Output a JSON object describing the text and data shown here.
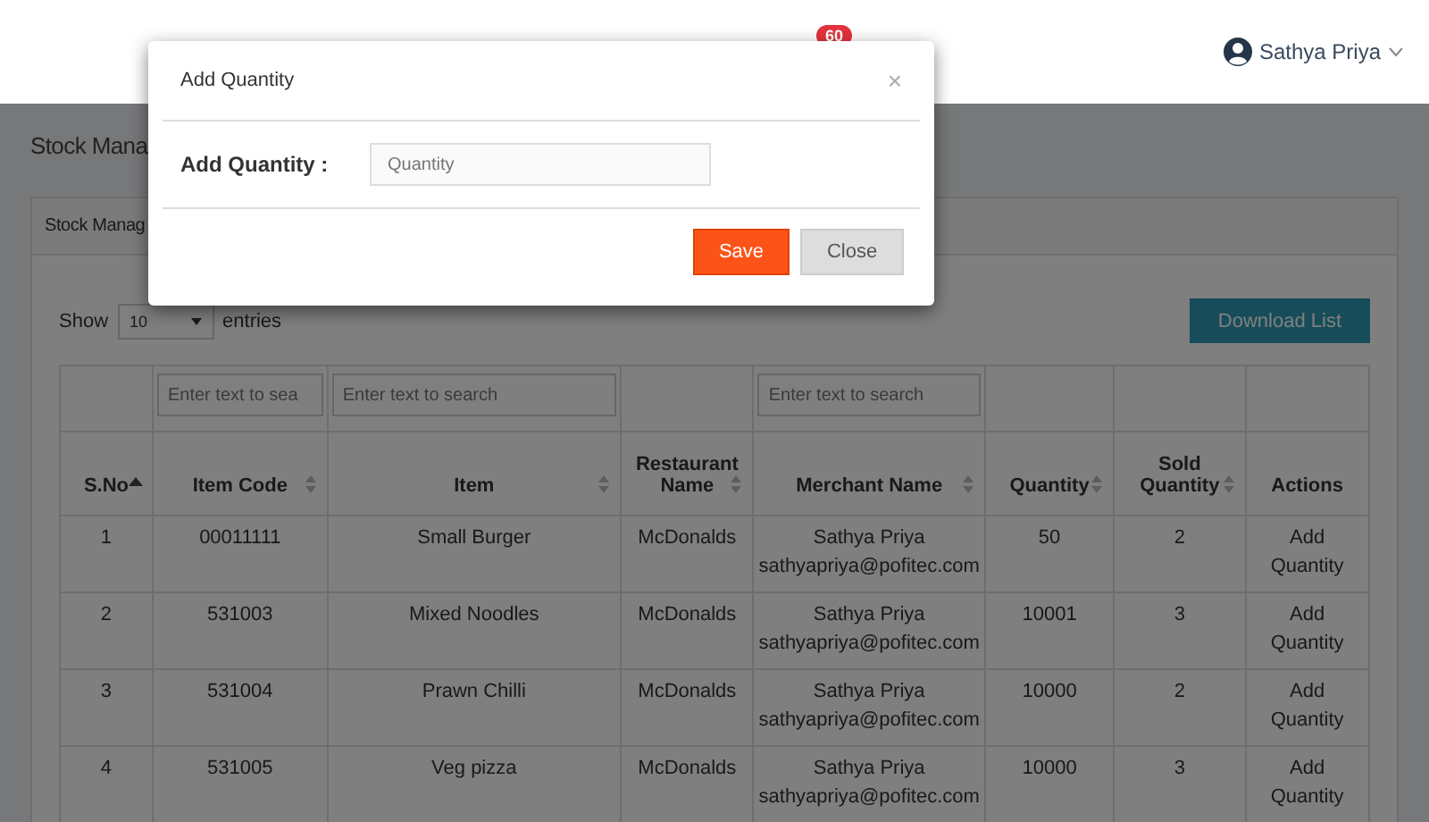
{
  "header": {
    "notification_badge": "60",
    "user_name": "Sathya Priya"
  },
  "page_title": "Stock Mana",
  "card_title": "Stock Manag",
  "length_control": {
    "label_before": "Show",
    "value": "10",
    "label_after": "entries"
  },
  "download_button": "Download List",
  "table": {
    "filters": [
      {
        "kind": "none"
      },
      {
        "kind": "input",
        "placeholder": "Enter text to sea"
      },
      {
        "kind": "input",
        "placeholder": "Enter text to search"
      },
      {
        "kind": "none"
      },
      {
        "kind": "input",
        "placeholder": "Enter text to search"
      },
      {
        "kind": "none"
      },
      {
        "kind": "none"
      },
      {
        "kind": "none"
      }
    ],
    "columns": [
      {
        "label": "S.No",
        "sorted": true
      },
      {
        "label": "Item Code",
        "sorted": false
      },
      {
        "label": "Item",
        "sorted": false
      },
      {
        "label": "Restaurant Name",
        "sorted": false
      },
      {
        "label": "Merchant Name",
        "sorted": false
      },
      {
        "label": "Quantity",
        "sorted": false
      },
      {
        "label": "Sold Quantity",
        "sorted": false
      },
      {
        "label": "Actions"
      }
    ],
    "rows": [
      {
        "sno": "1",
        "item_code": "00011111",
        "item": "Small Burger",
        "restaurant": "McDonalds",
        "merchant_name": "Sathya Priya",
        "merchant_email": "sathyapriya@pofitec.com",
        "quantity": "50",
        "sold_quantity": "2",
        "action": "Add Quantity"
      },
      {
        "sno": "2",
        "item_code": "531003",
        "item": "Mixed Noodles",
        "restaurant": "McDonalds",
        "merchant_name": "Sathya Priya",
        "merchant_email": "sathyapriya@pofitec.com",
        "quantity": "10001",
        "sold_quantity": "3",
        "action": "Add Quantity"
      },
      {
        "sno": "3",
        "item_code": "531004",
        "item": "Prawn Chilli",
        "restaurant": "McDonalds",
        "merchant_name": "Sathya Priya",
        "merchant_email": "sathyapriya@pofitec.com",
        "quantity": "10000",
        "sold_quantity": "2",
        "action": "Add Quantity"
      },
      {
        "sno": "4",
        "item_code": "531005",
        "item": "Veg pizza",
        "restaurant": "McDonalds",
        "merchant_name": "Sathya Priya",
        "merchant_email": "sathyapriya@pofitec.com",
        "quantity": "10000",
        "sold_quantity": "3",
        "action": "Add Quantity"
      }
    ]
  },
  "modal": {
    "title": "Add Quantity",
    "close_symbol": "×",
    "field_label": "Add Quantity :",
    "field_placeholder": "Quantity",
    "buttons": [
      {
        "label": "Save",
        "kind": "primary"
      },
      {
        "label": "Close",
        "kind": "secondary"
      }
    ]
  }
}
